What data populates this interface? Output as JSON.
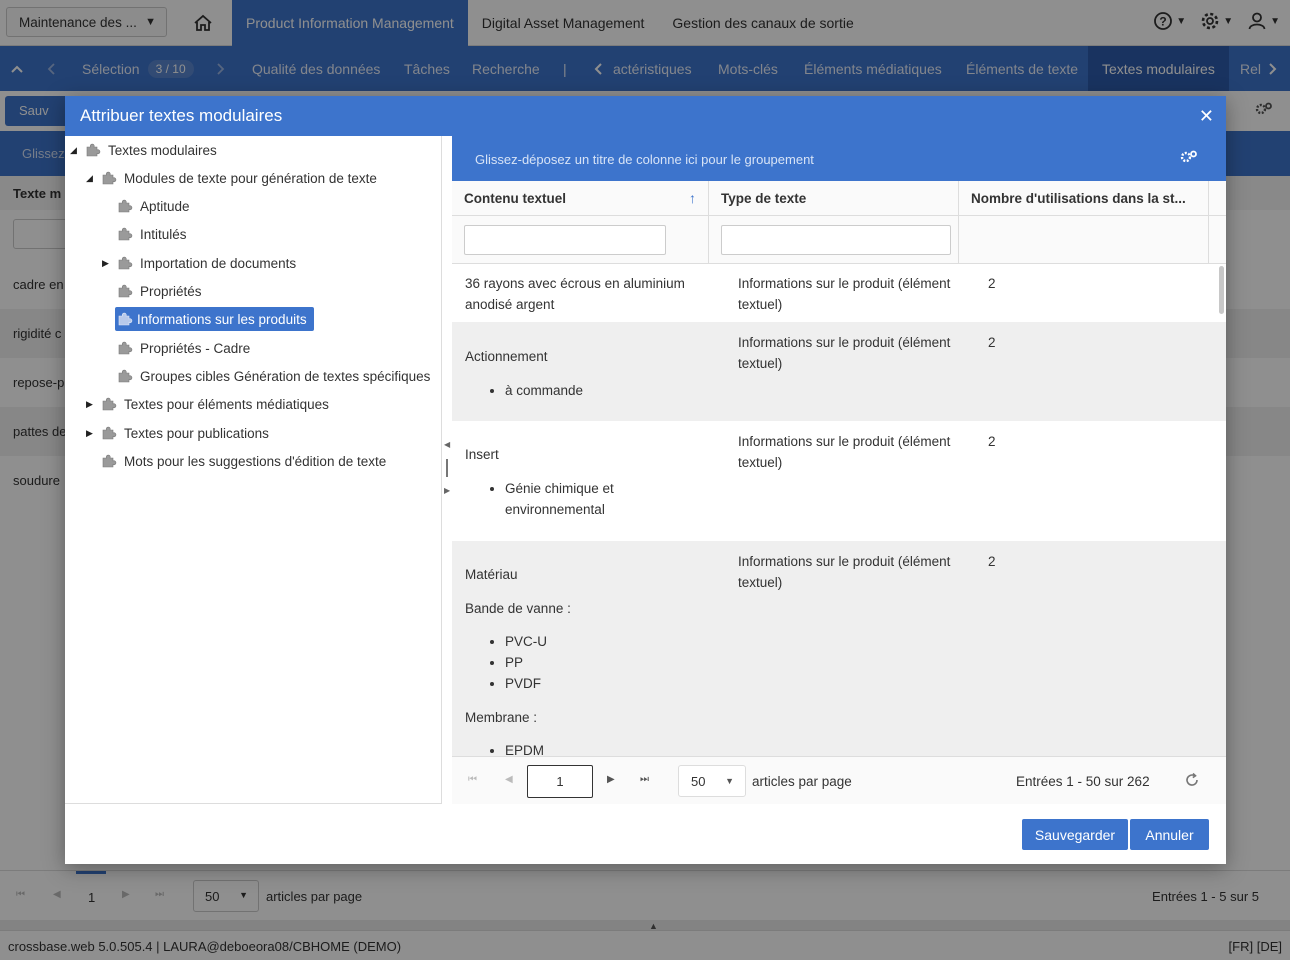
{
  "topbar": {
    "workspace": "Maintenance des ...",
    "nav": [
      "Product Information Management",
      "Digital Asset Management",
      "Gestion des canaux de sortie"
    ]
  },
  "secbar": {
    "selection_label": "Sélection",
    "selection_count": "3 / 10",
    "items_left": [
      "Qualité des données",
      "Tâches",
      "Recherche"
    ],
    "separator": "|",
    "items_right": [
      "actéristiques",
      "Mots-clés",
      "Éléments médiatiques",
      "Éléments de texte",
      "Textes modulaires",
      "Rel"
    ]
  },
  "background": {
    "save_label": "Sauv",
    "group_hint": "Glissez",
    "column_header": "Texte m",
    "rows": [
      "cadre en",
      "rigidité c",
      "repose-p",
      "pattes de",
      "soudure"
    ],
    "pager": {
      "page": "1",
      "per_page": "50",
      "per_page_label": "articles par page",
      "entries": "Entrées 1 - 5 sur 5"
    }
  },
  "statusbar": {
    "info": "crossbase.web 5.0.505.4 | LAURA@deboeora08/CBHOME (DEMO)",
    "lang": "[FR] [DE]"
  },
  "modal": {
    "title": "Attribuer textes modulaires",
    "tree": {
      "root": "Textes modulaires",
      "n1": "Modules de texte pour génération de texte",
      "n1_children": [
        "Aptitude",
        "Intitulés",
        "Importation de documents",
        "Propriétés",
        "Informations sur les produits",
        "Propriétés - Cadre",
        "Groupes cibles Génération de textes spécifiques"
      ],
      "n2": "Textes pour éléments médiatiques",
      "n3": "Textes pour publications",
      "n4": "Mots pour les suggestions d'édition de texte"
    },
    "grid": {
      "group_hint": "Glissez-déposez un titre de colonne ici pour le groupement",
      "headers": [
        "Contenu textuel",
        "Type de texte",
        "Nombre d'utilisations dans la st..."
      ],
      "rows": [
        {
          "content": "36 rayons avec écrous en aluminium anodisé argent",
          "type": "Informations sur le produit (élément textuel)",
          "count": "2"
        },
        {
          "heading": "Actionnement",
          "bullets": [
            "à commande"
          ],
          "type": "Informations sur le produit (élément textuel)",
          "count": "2"
        },
        {
          "heading": "Insert",
          "bullets": [
            "Génie chimique et environnemental"
          ],
          "type": "Informations sur le produit (élément textuel)",
          "count": "2"
        },
        {
          "heading": "Matériau",
          "sub1": "Bande de vanne :",
          "bullets1": [
            "PVC-U",
            "PP",
            "PVDF"
          ],
          "sub2": "Membrane :",
          "bullets2": [
            "EPDM"
          ],
          "type": "Informations sur le produit (élément textuel)",
          "count": "2"
        }
      ],
      "pager": {
        "page": "1",
        "per_page": "50",
        "per_page_label": "articles par page",
        "entries": "Entrées 1 - 50 sur 262"
      }
    },
    "buttons": {
      "save": "Sauvegarder",
      "cancel": "Annuler"
    }
  }
}
